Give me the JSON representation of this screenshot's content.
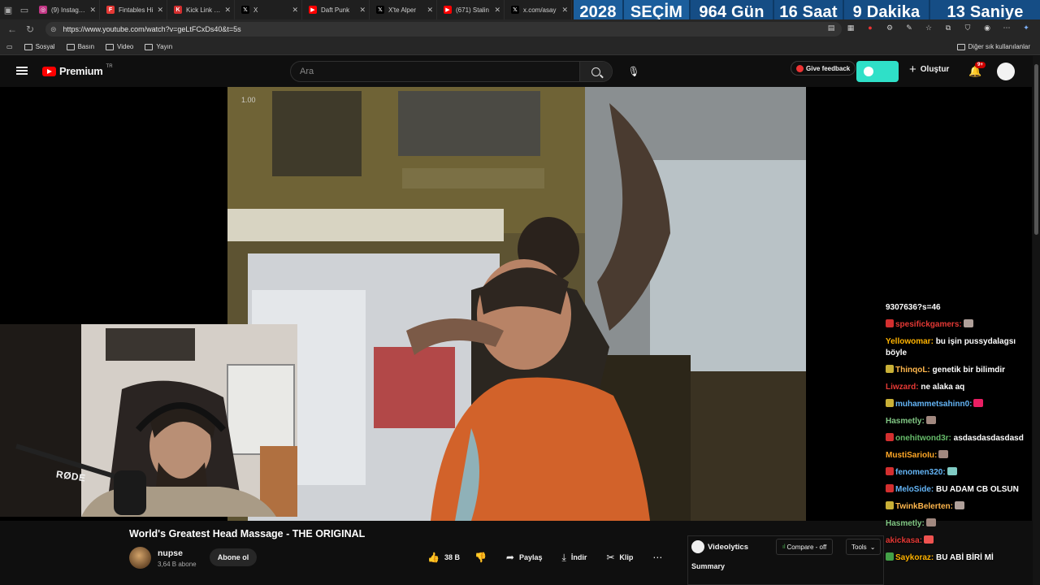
{
  "browser": {
    "tabs": [
      {
        "label": "(9) Instagram",
        "color": "#c13584",
        "glyph": "◎"
      },
      {
        "label": "Fintables Hi",
        "color": "#e53935",
        "glyph": "F"
      },
      {
        "label": "Kick Link Cu",
        "color": "#d32f2f",
        "glyph": "K"
      },
      {
        "label": "X",
        "color": "#000000",
        "glyph": "𝕏"
      },
      {
        "label": "Daft Punk",
        "color": "#ff0000",
        "glyph": "▶"
      },
      {
        "label": "X'te Alper",
        "color": "#000000",
        "glyph": "𝕏"
      },
      {
        "label": "(671) Stalin",
        "color": "#ff0000",
        "glyph": "▶"
      },
      {
        "label": "x.com/asay",
        "color": "#000000",
        "glyph": "𝕏"
      }
    ],
    "url": "https://www.youtube.com/watch?v=geLtFCxDs40&t=5s",
    "bookmarks": [
      "Sosyal",
      "Basın",
      "Video",
      "Yayın"
    ],
    "bookmarks_other": "Diğer sık kullanılanlar"
  },
  "countdown": {
    "year": "2028",
    "label": "SEÇİM",
    "days": "964 Gün",
    "hours": "16 Saat",
    "minutes": "9 Dakika",
    "seconds": "13 Saniye"
  },
  "youtube": {
    "brand": "Premium",
    "region": "TR",
    "search_placeholder": "Ara",
    "feedback_label": "Give feedback",
    "create_label": "Oluştur",
    "notif_count": "9+"
  },
  "player": {
    "speed_label": "1.00",
    "mic_brand": "RØDE"
  },
  "chat": [
    {
      "user": "",
      "text": "9307636?s=46",
      "color": "#ffffff",
      "badge": "",
      "emote": ""
    },
    {
      "user": "spesifickgamers:",
      "text": "",
      "color": "#e53935",
      "badge": "#d32f2f",
      "emote": "#b0a09a"
    },
    {
      "user": "Yellowomar:",
      "text": "bu işin pussydalagsı böyle",
      "color": "#ffb300",
      "badge": "",
      "emote": ""
    },
    {
      "user": "ThinqoL:",
      "text": "genetik bir bilimdir",
      "color": "#ffb74d",
      "badge": "#c9b037",
      "emote": ""
    },
    {
      "user": "Liwzard:",
      "text": "ne alaka aq",
      "color": "#e53935",
      "badge": "",
      "emote": ""
    },
    {
      "user": "muhammetsahinn0:",
      "text": "",
      "color": "#64b5f6",
      "badge": "#c9b037",
      "emote": "#e91e63"
    },
    {
      "user": "Hasmetly:",
      "text": "",
      "color": "#81c784",
      "badge": "",
      "emote": "#a1887f"
    },
    {
      "user": "onehitwond3r:",
      "text": "asdasdasdasdasd",
      "color": "#66bb6a",
      "badge": "#d32f2f",
      "emote": ""
    },
    {
      "user": "MustiSarioIu:",
      "text": "",
      "color": "#ffa726",
      "badge": "",
      "emote": "#a1887f"
    },
    {
      "user": "fenomen320:",
      "text": "",
      "color": "#64b5f6",
      "badge": "#d32f2f",
      "emote": "#80cbc4"
    },
    {
      "user": "MeloSide:",
      "text": "BU ADAM CB OLSUN",
      "color": "#64b5f6",
      "badge": "#d32f2f",
      "emote": ""
    },
    {
      "user": "TwinkBelerten:",
      "text": "",
      "color": "#ffb74d",
      "badge": "#c9b037",
      "emote": "#b0a09a"
    },
    {
      "user": "Hasmetly:",
      "text": "",
      "color": "#81c784",
      "badge": "",
      "emote": "#a1887f"
    },
    {
      "user": "akickasa:",
      "text": "",
      "color": "#e53935",
      "badge": "",
      "emote": "#ef5350"
    },
    {
      "user": "Saykoraz:",
      "text": "BU ABİ BİRİ Mİ",
      "color": "#ffb300",
      "badge": "#43a047",
      "emote": ""
    }
  ],
  "video": {
    "title": "World's Greatest Head Massage - THE ORIGINAL",
    "channel": "nupse",
    "subscribers": "3,64 B abone",
    "subscribe_label": "Abone ol",
    "likes": "38 B",
    "share_label": "Paylaş",
    "download_label": "İndir",
    "clip_label": "Klip"
  },
  "videolytics": {
    "name": "Videolytics",
    "compare_label": "Compare - off",
    "tools_label": "Tools",
    "summary_label": "Summary"
  }
}
